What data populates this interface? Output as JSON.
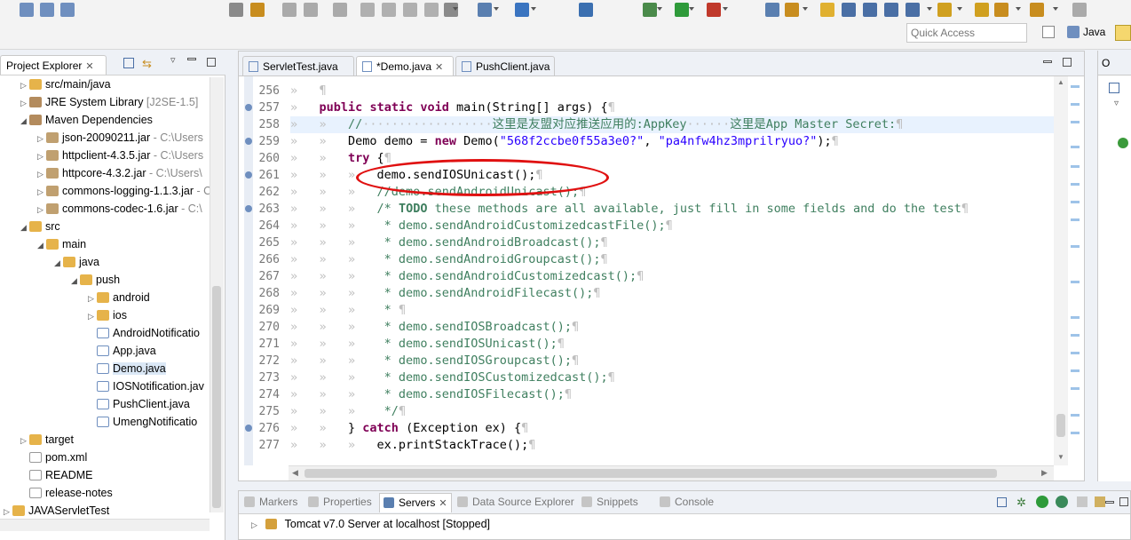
{
  "toolbar": {
    "quick_access_placeholder": "Quick Access",
    "perspective_label": "Java"
  },
  "explorer": {
    "tab_label": "Project Explorer",
    "tree": [
      {
        "indent": 1,
        "arrow": "▷",
        "icon": "folder",
        "label": "src/main/java",
        "deco": ""
      },
      {
        "indent": 1,
        "arrow": "▷",
        "icon": "lib",
        "label": "JRE System Library",
        "deco": "[J2SE-1.5]"
      },
      {
        "indent": 1,
        "arrow": "◢",
        "icon": "lib",
        "label": "Maven Dependencies",
        "deco": ""
      },
      {
        "indent": 2,
        "arrow": "▷",
        "icon": "jar",
        "label": "json-20090211.jar",
        "deco": "- C:\\Users"
      },
      {
        "indent": 2,
        "arrow": "▷",
        "icon": "jar",
        "label": "httpclient-4.3.5.jar",
        "deco": "- C:\\Users"
      },
      {
        "indent": 2,
        "arrow": "▷",
        "icon": "jar",
        "label": "httpcore-4.3.2.jar",
        "deco": "- C:\\Users\\"
      },
      {
        "indent": 2,
        "arrow": "▷",
        "icon": "jar",
        "label": "commons-logging-1.1.3.jar",
        "deco": "- C"
      },
      {
        "indent": 2,
        "arrow": "▷",
        "icon": "jar",
        "label": "commons-codec-1.6.jar",
        "deco": "- C:\\"
      },
      {
        "indent": 1,
        "arrow": "◢",
        "icon": "folder",
        "label": "src",
        "deco": ""
      },
      {
        "indent": 2,
        "arrow": "◢",
        "icon": "folder",
        "label": "main",
        "deco": ""
      },
      {
        "indent": 3,
        "arrow": "◢",
        "icon": "folder",
        "label": "java",
        "deco": ""
      },
      {
        "indent": 4,
        "arrow": "◢",
        "icon": "folder",
        "label": "push",
        "deco": ""
      },
      {
        "indent": 5,
        "arrow": "▷",
        "icon": "folder",
        "label": "android",
        "deco": ""
      },
      {
        "indent": 5,
        "arrow": "▷",
        "icon": "folder",
        "label": "ios",
        "deco": ""
      },
      {
        "indent": 5,
        "arrow": "",
        "icon": "jfile",
        "label": "AndroidNotificatio",
        "deco": ""
      },
      {
        "indent": 5,
        "arrow": "",
        "icon": "jfile",
        "label": "App.java",
        "deco": ""
      },
      {
        "indent": 5,
        "arrow": "",
        "icon": "jfile",
        "label": "Demo.java",
        "deco": ""
      },
      {
        "indent": 5,
        "arrow": "",
        "icon": "jfile",
        "label": "IOSNotification.jav",
        "deco": ""
      },
      {
        "indent": 5,
        "arrow": "",
        "icon": "jfile",
        "label": "PushClient.java",
        "deco": ""
      },
      {
        "indent": 5,
        "arrow": "",
        "icon": "jfile",
        "label": "UmengNotificatio",
        "deco": ""
      },
      {
        "indent": 1,
        "arrow": "▷",
        "icon": "folder",
        "label": "target",
        "deco": ""
      },
      {
        "indent": 1,
        "arrow": "",
        "icon": "file",
        "label": "pom.xml",
        "deco": ""
      },
      {
        "indent": 1,
        "arrow": "",
        "icon": "file",
        "label": "README",
        "deco": ""
      },
      {
        "indent": 1,
        "arrow": "",
        "icon": "file",
        "label": "release-notes",
        "deco": ""
      },
      {
        "indent": 0,
        "arrow": "▷",
        "icon": "folder",
        "label": "JAVAServletTest",
        "deco": ""
      }
    ]
  },
  "editor": {
    "tabs": [
      {
        "label": "ServletTest.java",
        "active": false
      },
      {
        "label": "*Demo.java",
        "active": true
      },
      {
        "label": "PushClient.java",
        "active": false
      }
    ],
    "lines": [
      {
        "n": "256",
        "html": "<span class=\"ws\">»   ¶</span>"
      },
      {
        "n": "257",
        "html": "<span class=\"ws\">»   </span><span class=\"kw\">public</span> <span class=\"kw\">static</span> <span class=\"kw\">void</span> main(String[] args) {<span class=\"ws\">¶</span>"
      },
      {
        "n": "258",
        "html": "<span class=\"ws\">»   »   </span><span class=\"cm\">//<span class=\"ws\">··················</span>这里是友盟对应推送应用的:AppKey<span class=\"ws\">······</span>这里是App Master Secret:</span><span class=\"ws\">¶</span>",
        "current": true
      },
      {
        "n": "259",
        "html": "<span class=\"ws\">»   »   </span>Demo demo = <span class=\"kw\">new</span> Demo(<span class=\"str\">\"568f2ccbe0f55a3e0?\"</span>, <span class=\"str\">\"pa4nfw4hz3mprilryuo?\"</span>);<span class=\"ws\">¶</span>"
      },
      {
        "n": "260",
        "html": "<span class=\"ws\">»   »   </span><span class=\"kw\">try</span> {<span class=\"ws\">¶</span>"
      },
      {
        "n": "261",
        "html": "<span class=\"ws\">»   »   »   </span>demo.sendIOSUnicast();<span class=\"ws\">¶</span>"
      },
      {
        "n": "262",
        "html": "<span class=\"ws\">»   »   »   </span><span class=\"cm\">//demo.sendAndroidUnicast();</span><span class=\"ws\">¶</span>"
      },
      {
        "n": "263",
        "html": "<span class=\"ws\">»   »   »   </span><span class=\"cm\">/* <b>TODO</b> these methods are all available, just fill in some fields and do the test</span><span class=\"ws\">¶</span>"
      },
      {
        "n": "264",
        "html": "<span class=\"ws\">»   »   »   </span><span class=\"cm\"> * demo.sendAndroidCustomizedcastFile();</span><span class=\"ws\">¶</span>"
      },
      {
        "n": "265",
        "html": "<span class=\"ws\">»   »   »   </span><span class=\"cm\"> * demo.sendAndroidBroadcast();</span><span class=\"ws\">¶</span>"
      },
      {
        "n": "266",
        "html": "<span class=\"ws\">»   »   »   </span><span class=\"cm\"> * demo.sendAndroidGroupcast();</span><span class=\"ws\">¶</span>"
      },
      {
        "n": "267",
        "html": "<span class=\"ws\">»   »   »   </span><span class=\"cm\"> * demo.sendAndroidCustomizedcast();</span><span class=\"ws\">¶</span>"
      },
      {
        "n": "268",
        "html": "<span class=\"ws\">»   »   »   </span><span class=\"cm\"> * demo.sendAndroidFilecast();</span><span class=\"ws\">¶</span>"
      },
      {
        "n": "269",
        "html": "<span class=\"ws\">»   »   »   </span><span class=\"cm\"> * </span><span class=\"ws\">¶</span>"
      },
      {
        "n": "270",
        "html": "<span class=\"ws\">»   »   »   </span><span class=\"cm\"> * demo.sendIOSBroadcast();</span><span class=\"ws\">¶</span>"
      },
      {
        "n": "271",
        "html": "<span class=\"ws\">»   »   »   </span><span class=\"cm\"> * demo.sendIOSUnicast();</span><span class=\"ws\">¶</span>"
      },
      {
        "n": "272",
        "html": "<span class=\"ws\">»   »   »   </span><span class=\"cm\"> * demo.sendIOSGroupcast();</span><span class=\"ws\">¶</span>"
      },
      {
        "n": "273",
        "html": "<span class=\"ws\">»   »   »   </span><span class=\"cm\"> * demo.sendIOSCustomizedcast();</span><span class=\"ws\">¶</span>"
      },
      {
        "n": "274",
        "html": "<span class=\"ws\">»   »   »   </span><span class=\"cm\"> * demo.sendIOSFilecast();</span><span class=\"ws\">¶</span>"
      },
      {
        "n": "275",
        "html": "<span class=\"ws\">»   »   »   </span><span class=\"cm\"> */</span><span class=\"ws\">¶</span>"
      },
      {
        "n": "276",
        "html": "<span class=\"ws\">»   »   </span>} <span class=\"kw\">catch</span> (Exception ex) {<span class=\"ws\">¶</span>"
      },
      {
        "n": "277",
        "html": "<span class=\"ws\">»   »   »   </span>ex.printStackTrace();<span class=\"ws\">¶</span>"
      }
    ]
  },
  "bottom": {
    "tabs": [
      {
        "label": "Markers",
        "active": false
      },
      {
        "label": "Properties",
        "active": false
      },
      {
        "label": "Servers",
        "active": true
      },
      {
        "label": "Data Source Explorer",
        "active": false
      },
      {
        "label": "Snippets",
        "active": false
      },
      {
        "label": "Console",
        "active": false
      }
    ],
    "server_row": "Tomcat v7.0 Server at localhost  [Stopped]"
  },
  "outline": {
    "tab_label": "O"
  },
  "colors": {
    "keyword": "#7f0055",
    "string": "#2a00ff",
    "comment": "#3f7f5f",
    "annotation_oval": "#e01010"
  }
}
